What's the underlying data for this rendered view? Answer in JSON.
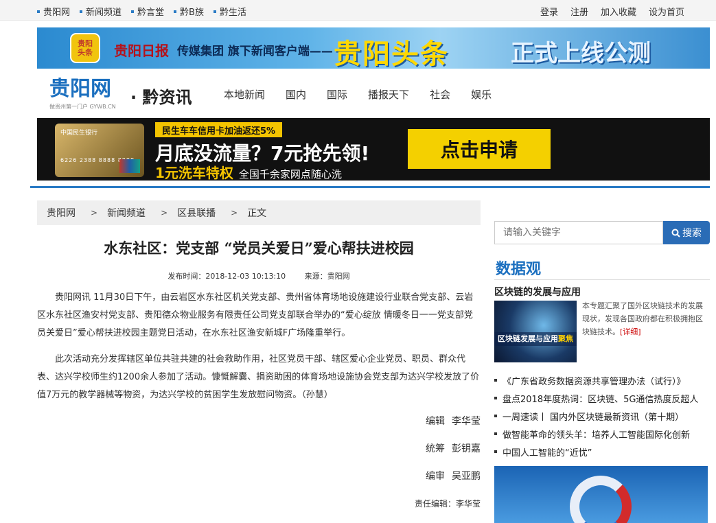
{
  "topnav": {
    "left": [
      "贵阳网",
      "新闻频道",
      "黔言堂",
      "黔B族",
      "黔生活"
    ],
    "right": [
      "登录",
      "注册",
      "加入收藏",
      "设为首页"
    ]
  },
  "banner_top": {
    "icon_line1": "贵阳",
    "icon_line2": "头条",
    "paper": "贵阳日报",
    "group": "传媒集团 旗下新闻客户端——",
    "big": "贵阳头条",
    "beta": "正式上线公测"
  },
  "header": {
    "logo": "贵阳网",
    "logo_tag": "做贵州第一门户 GYWB.CN",
    "channel": "· 黔资讯",
    "nav": [
      "本地新闻",
      "国内",
      "国际",
      "播报天下",
      "社会",
      "娱乐"
    ]
  },
  "banner_ad": {
    "bank": "中国民生银行",
    "card_num": "6226 2388 8888 8888",
    "line1": "民生车车信用卡加油返还5%",
    "line2": "月底没流量？7元抢先领!",
    "line3": "1元洗车特权",
    "line3b": "全国千余家网点随心洗",
    "apply": "点击申请"
  },
  "breadcrumb": [
    "贵阳网",
    "新闻频道",
    "区县联播",
    "正文"
  ],
  "article": {
    "title": "水东社区：党支部 “党员关爱日”爱心帮扶进校园",
    "publish_time": "发布时间：2018-12-03 10:13:10",
    "source": "来源：贵阳网",
    "p1": "贵阳网讯 11月30日下午，由云岩区水东社区机关党支部、贵州省体育场地设施建设行业联合党支部、云岩区水东社区渔安村党支部、贵阳德众物业服务有限责任公司党支部联合举办的“爱心绽放 情暖冬日一一党支部党员关爱日”爱心帮扶进校园主题党日活动，在水东社区渔安新城F广场隆重举行。",
    "p2": "此次活动充分发挥辖区单位共驻共建的社会救助作用，社区党员干部、辖区爱心企业党员、职员、群众代表、达兴学校师生约1200余人参加了活动。慷慨解囊、捐资助困的体育场地设施协会党支部为达兴学校发放了价值7万元的教学器械等物资，为达兴学校的贫困学生发放慰问物资。（孙慧）",
    "editor_label": "编辑",
    "editor": "李华莹",
    "planner_label": "统筹",
    "planner": "彭钥嘉",
    "reviewer_label": "编审",
    "reviewer": "吴亚鹏",
    "responsible": "责任编辑：李华莹"
  },
  "sidebar": {
    "search_placeholder": "请输入关键字",
    "search_button": "搜索",
    "section_title": "数据观",
    "topic_title": "区块链的发展与应用",
    "topic_img_label_a": "区块链发展与应用",
    "topic_img_label_b": "聚焦",
    "topic_text": "本专题汇聚了国外区块链技术的发展现状，发现各国政府都在积极拥抱区块链技术。",
    "topic_more": "[详细]",
    "news": [
      "《广东省政务数据资源共享管理办法（试行）》",
      "盘点2018年度热词：区块链、5G通信热度反超人",
      "一周速读丨 国内外区块链最新资讯（第十期）",
      "做智能革命的领头羊：培养人工智能国际化创新",
      "中国人工智能的“近忧”"
    ]
  },
  "colors": {
    "brand_blue": "#2a7bc5",
    "search_button": "#2a6cb6",
    "more_red": "#c00"
  }
}
